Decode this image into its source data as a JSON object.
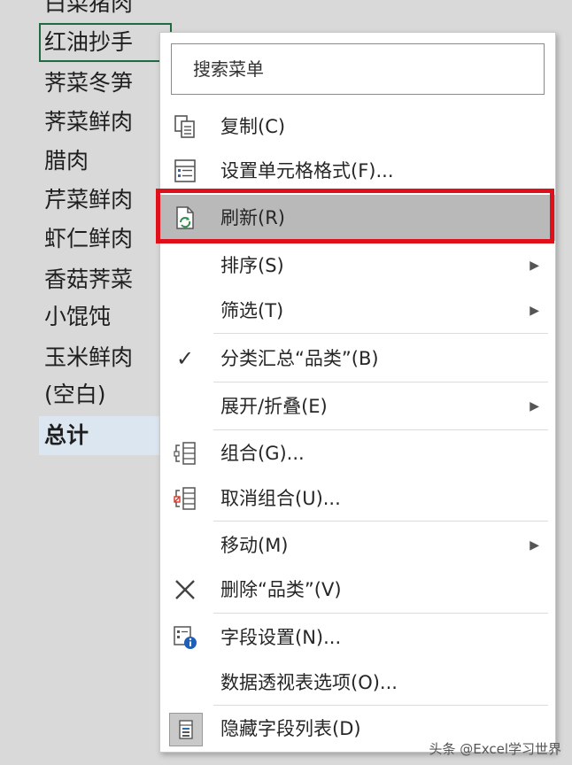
{
  "sheet": {
    "cells": [
      "白菜猪肉",
      "红油抄手",
      "荠菜冬笋",
      "荠菜鲜肉",
      "腊肉",
      "芹菜鲜肉",
      "虾仁鲜肉",
      "香菇荠菜",
      "小馄饨",
      "玉米鲜肉",
      "(空白)",
      "总计"
    ],
    "selected_index": 1
  },
  "menu": {
    "search_placeholder": "搜索菜单",
    "items": [
      {
        "label": "复制(C)",
        "icon": "copy-icon",
        "arrow": false
      },
      {
        "label": "设置单元格格式(F)...",
        "icon": "format-cells-icon",
        "arrow": false
      },
      {
        "label": "刷新(R)",
        "icon": "refresh-icon",
        "arrow": false,
        "highlighted": true
      },
      {
        "label": "排序(S)",
        "icon": "",
        "arrow": true
      },
      {
        "label": "筛选(T)",
        "icon": "",
        "arrow": true
      },
      {
        "label": "分类汇总“品类”(B)",
        "icon": "checkmark-icon",
        "arrow": false
      },
      {
        "label": "展开/折叠(E)",
        "icon": "",
        "arrow": true
      },
      {
        "label": "组合(G)...",
        "icon": "group-icon",
        "arrow": false
      },
      {
        "label": "取消组合(U)...",
        "icon": "ungroup-icon",
        "arrow": false
      },
      {
        "label": "移动(M)",
        "icon": "",
        "arrow": true
      },
      {
        "label": "删除“品类”(V)",
        "icon": "delete-x-icon",
        "arrow": false
      },
      {
        "label": "字段设置(N)...",
        "icon": "field-settings-icon",
        "arrow": false
      },
      {
        "label": "数据透视表选项(O)...",
        "icon": "",
        "arrow": false
      },
      {
        "label": "隐藏字段列表(D)",
        "icon": "field-list-icon",
        "arrow": false
      }
    ]
  },
  "watermark": "头条 @Excel学习世界",
  "colors": {
    "highlight": "#b9b9b9",
    "red_box": "#e0101b",
    "selection": "#1e6b3f"
  }
}
